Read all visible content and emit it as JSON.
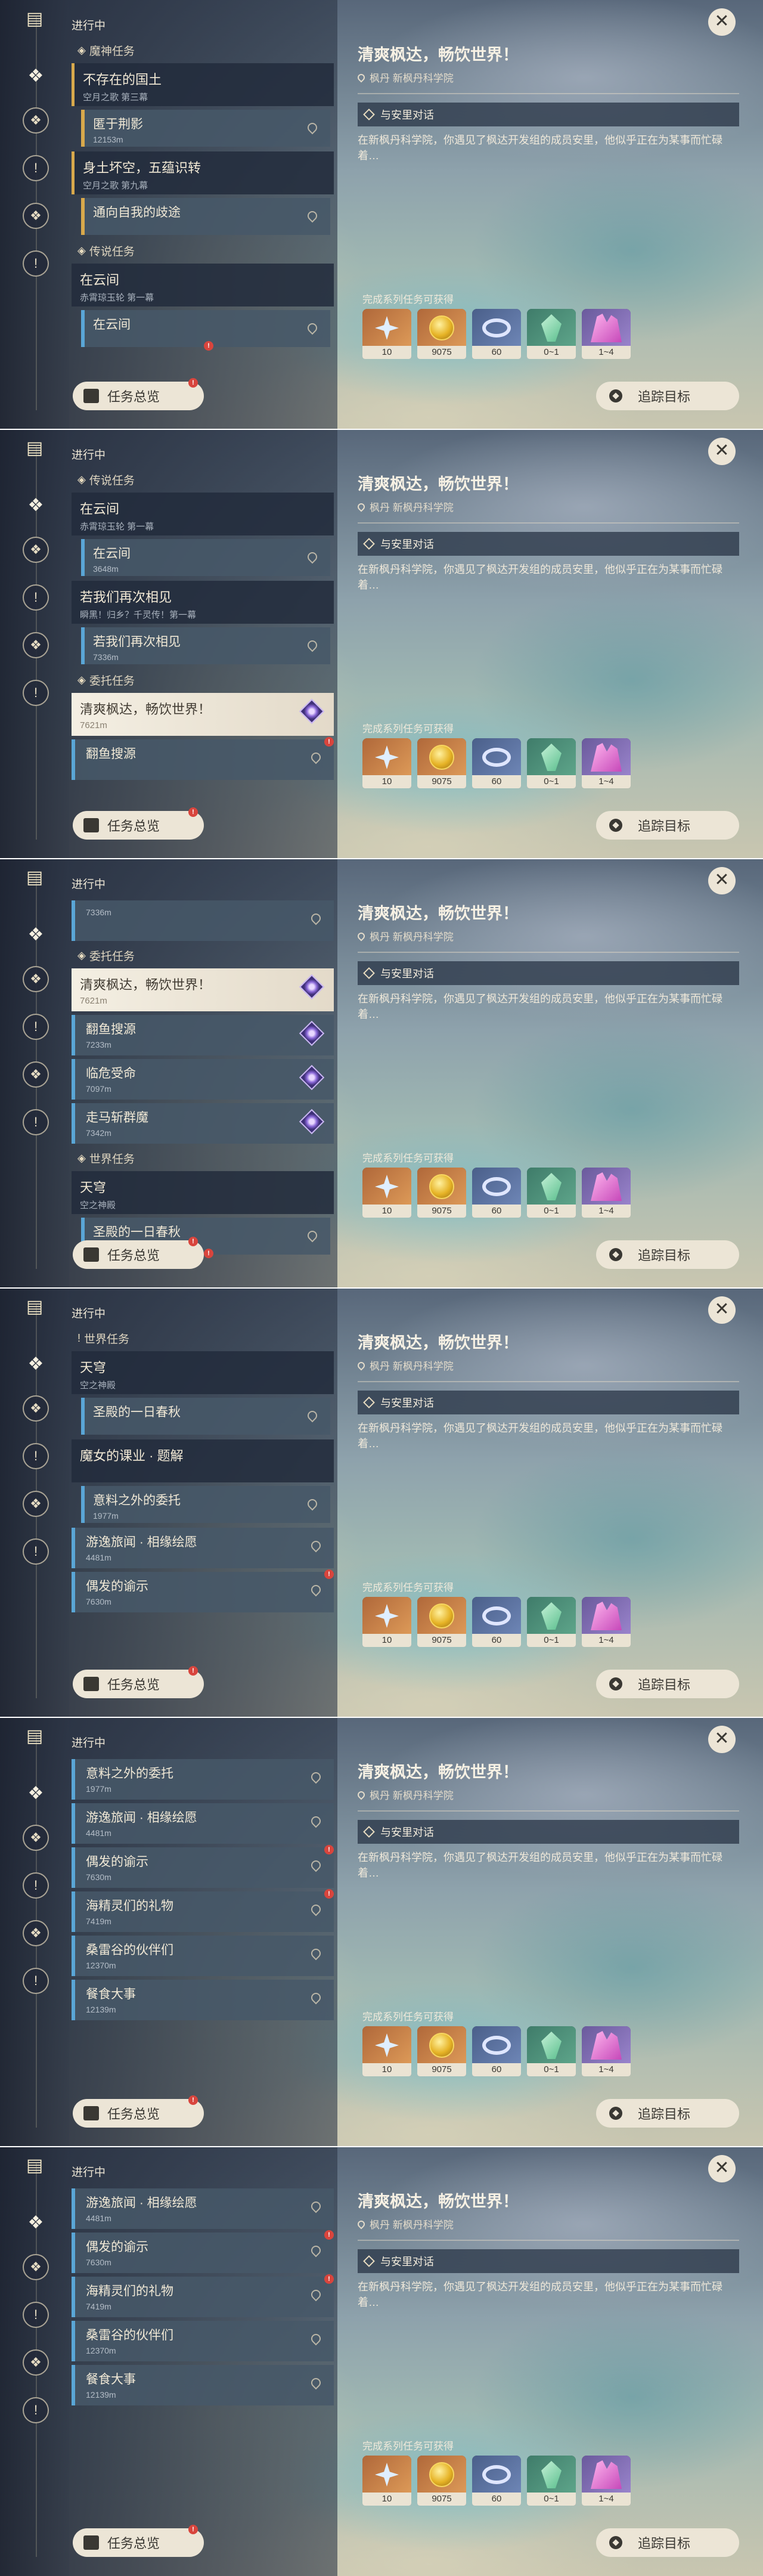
{
  "common": {
    "in_progress": "进行中",
    "summary_button": "任务总览",
    "track_button": "追踪目标",
    "close_glyph": "✕",
    "detail": {
      "title": "清爽枫达，畅饮世界！",
      "location": "枫丹 新枫丹科学院",
      "objective": "与安里对话",
      "description": "在新枫丹科学院，你遇见了枫达开发组的成员安里，他似乎正在为某事而忙碌着…",
      "rewards_label": "完成系列任务可获得"
    },
    "rewards": [
      {
        "icon": "primogem-star-icon",
        "count": "10"
      },
      {
        "icon": "mora-coin-icon",
        "count": "9075"
      },
      {
        "icon": "fate-ring-icon",
        "count": "60"
      },
      {
        "icon": "green-crystal-icon",
        "count": "0~1"
      },
      {
        "icon": "pink-crystals-icon",
        "count": "1~4"
      }
    ]
  },
  "panels": [
    {
      "items": [
        {
          "kind": "head",
          "sym": "◈",
          "text": "魔神任务"
        },
        {
          "kind": "card",
          "title": "不存在的国土",
          "sub": "空月之歌 第三幕",
          "gold": true
        },
        {
          "kind": "sub",
          "title": "匿于荆影",
          "sub": "12153m",
          "color": "gold"
        },
        {
          "kind": "card",
          "title": "身土坏空，五蕴识转",
          "sub": "空月之歌 第九幕",
          "gold": true
        },
        {
          "kind": "sub",
          "title": "通向自我的歧途",
          "sub": "",
          "color": "gold"
        },
        {
          "kind": "head",
          "sym": "◈",
          "text": "传说任务"
        },
        {
          "kind": "card",
          "title": "在云间",
          "sub": "赤霄琼玉轮 第一幕",
          "gold": false
        },
        {
          "kind": "sub",
          "title": "在云间",
          "sub": "",
          "color": "blue",
          "badge": true
        }
      ]
    },
    {
      "items": [
        {
          "kind": "head",
          "sym": "◈",
          "text": "传说任务"
        },
        {
          "kind": "card",
          "title": "在云间",
          "sub": "赤霄琼玉轮 第一幕",
          "gold": false
        },
        {
          "kind": "sub",
          "title": "在云间",
          "sub": "3648m",
          "color": "blue"
        },
        {
          "kind": "card",
          "title": "若我们再次相见",
          "sub": "瞬黑！归乡？千灵传！第一幕",
          "gold": false
        },
        {
          "kind": "sub",
          "title": "若我们再次相见",
          "sub": "7336m",
          "color": "blue"
        },
        {
          "kind": "head",
          "sym": "◈",
          "text": "委托任务"
        },
        {
          "kind": "sel",
          "title": "清爽枫达，畅饮世界！",
          "sub": "7621m",
          "gem": true
        },
        {
          "kind": "row",
          "title": "翻鱼搜源",
          "sub": "",
          "gem": false,
          "badge": true
        }
      ]
    },
    {
      "items": [
        {
          "kind": "row",
          "title": "",
          "sub": "7336m",
          "gem": false
        },
        {
          "kind": "head",
          "sym": "◈",
          "text": "委托任务"
        },
        {
          "kind": "sel",
          "title": "清爽枫达，畅饮世界！",
          "sub": "7621m",
          "gem": true
        },
        {
          "kind": "row",
          "title": "翻鱼搜源",
          "sub": "7233m",
          "gem": true
        },
        {
          "kind": "row",
          "title": "临危受命",
          "sub": "7097m",
          "gem": true
        },
        {
          "kind": "row",
          "title": "走马斩群魔",
          "sub": "7342m",
          "gem": true
        },
        {
          "kind": "head",
          "sym": "◈",
          "text": "世界任务"
        },
        {
          "kind": "card",
          "title": "天穹",
          "sub": "空之神殿",
          "gold": false
        },
        {
          "kind": "sub",
          "title": "圣殿的一日春秋",
          "sub": "",
          "color": "blue",
          "badge": true
        }
      ]
    },
    {
      "items": [
        {
          "kind": "head",
          "sym": "!",
          "text": "世界任务"
        },
        {
          "kind": "card",
          "title": "天穹",
          "sub": "空之神殿",
          "gold": false
        },
        {
          "kind": "sub",
          "title": "圣殿的一日春秋",
          "sub": "",
          "color": "blue"
        },
        {
          "kind": "card",
          "title": "魔女的课业 · 题解",
          "sub": "",
          "gold": false
        },
        {
          "kind": "sub",
          "title": "意料之外的委托",
          "sub": "1977m",
          "color": "blue"
        },
        {
          "kind": "row",
          "title": "游逸旅闻 · 相缘绘愿",
          "sub": "4481m",
          "gem": false
        },
        {
          "kind": "row",
          "title": "偶发的谕示",
          "sub": "7630m",
          "gem": false,
          "badge": true
        }
      ]
    },
    {
      "items": [
        {
          "kind": "row",
          "title": "意料之外的委托",
          "sub": "1977m",
          "gem": false
        },
        {
          "kind": "row",
          "title": "游逸旅闻 · 相缘绘愿",
          "sub": "4481m",
          "gem": false
        },
        {
          "kind": "row",
          "title": "偶发的谕示",
          "sub": "7630m",
          "gem": false,
          "badge": true
        },
        {
          "kind": "row",
          "title": "海精灵们的礼物",
          "sub": "7419m",
          "gem": false,
          "badge": true
        },
        {
          "kind": "row",
          "title": "桑雷谷的伙伴们",
          "sub": "12370m",
          "gem": false
        },
        {
          "kind": "row",
          "title": "餐食大事",
          "sub": "12139m",
          "gem": false
        }
      ]
    },
    {
      "items": [
        {
          "kind": "row",
          "title": "游逸旅闻 · 相缘绘愿",
          "sub": "4481m",
          "gem": false
        },
        {
          "kind": "row",
          "title": "偶发的谕示",
          "sub": "7630m",
          "gem": false,
          "badge": true
        },
        {
          "kind": "row",
          "title": "海精灵们的礼物",
          "sub": "7419m",
          "gem": false,
          "badge": true
        },
        {
          "kind": "row",
          "title": "桑雷谷的伙伴们",
          "sub": "12370m",
          "gem": false
        },
        {
          "kind": "row",
          "title": "餐食大事",
          "sub": "12139m",
          "gem": false
        }
      ]
    }
  ]
}
